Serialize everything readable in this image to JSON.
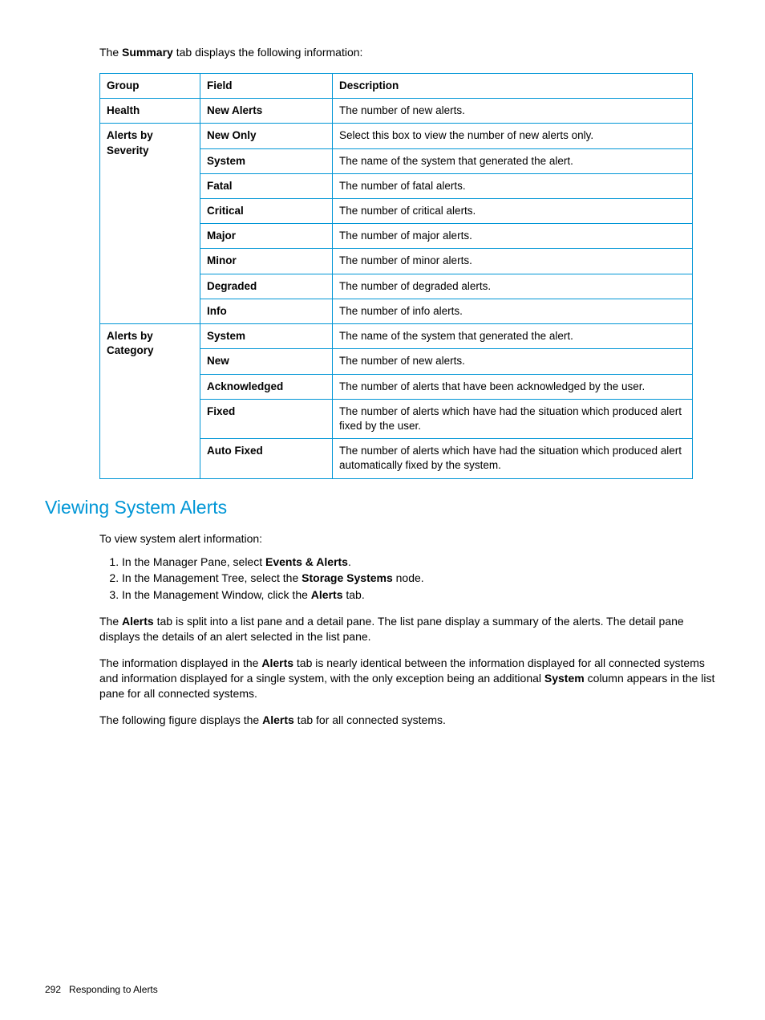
{
  "intro": {
    "pre": "The ",
    "bold": "Summary",
    "post": " tab displays the following information:"
  },
  "table": {
    "headers": {
      "group": "Group",
      "field": "Field",
      "desc": "Description"
    },
    "rows": [
      {
        "group": "Health",
        "rowspan": 1,
        "field": "New Alerts",
        "desc": "The number of new alerts."
      },
      {
        "group": "Alerts by Severity",
        "rowspan": 8,
        "field": "New Only",
        "desc": "Select this box to view the number of new alerts only."
      },
      {
        "field": "System",
        "desc": "The name of the system that generated the alert."
      },
      {
        "field": "Fatal",
        "desc": "The number of fatal alerts."
      },
      {
        "field": "Critical",
        "desc": "The number of critical alerts."
      },
      {
        "field": "Major",
        "desc": "The number of major alerts."
      },
      {
        "field": "Minor",
        "desc": "The number of minor alerts."
      },
      {
        "field": "Degraded",
        "desc": "The number of degraded alerts."
      },
      {
        "field": "Info",
        "desc": "The number of info alerts."
      },
      {
        "group": "Alerts by Category",
        "rowspan": 5,
        "field": "System",
        "desc": "The name of the system that generated the alert."
      },
      {
        "field": "New",
        "desc": "The number of new alerts."
      },
      {
        "field": "Acknowledged",
        "desc": "The number of alerts that have been acknowledged by the user."
      },
      {
        "field": "Fixed",
        "desc": "The number of alerts which have had the situation which produced alert fixed by the user."
      },
      {
        "field": "Auto Fixed",
        "desc": "The number of alerts which have had the situation which produced alert automatically fixed by the system."
      }
    ]
  },
  "heading": "Viewing System Alerts",
  "p_view": "To view system alert information:",
  "steps": [
    {
      "pre": "In the Manager Pane, select ",
      "bold": "Events & Alerts",
      "post": "."
    },
    {
      "pre": "In the Management Tree, select the ",
      "bold": "Storage Systems",
      "post": " node."
    },
    {
      "pre": "In the Management Window, click the ",
      "bold": "Alerts",
      "post": " tab."
    }
  ],
  "p1": {
    "pre": "The ",
    "b1": "Alerts",
    "mid": " tab is split into a list pane and a detail pane. The list pane display a summary of the alerts. The detail pane displays the details of an alert selected in the list pane."
  },
  "p2": {
    "pre": "The information displayed in the ",
    "b1": "Alerts",
    "mid1": " tab is nearly identical between the information displayed for all connected systems and information displayed for a single system, with the only exception being an additional ",
    "b2": "System",
    "mid2": " column appears in the list pane for all connected systems."
  },
  "p3": {
    "pre": "The following figure displays the ",
    "b1": "Alerts",
    "post": " tab for all connected systems."
  },
  "footer": {
    "page": "292",
    "title": "Responding to Alerts"
  }
}
